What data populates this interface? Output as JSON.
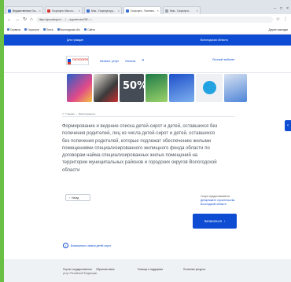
{
  "browser": {
    "tabs": [
      {
        "label": "Ведомственные Гос...",
        "active": false,
        "color": "#3b6fd0"
      },
      {
        "label": "Госуслуги: Мои кл...",
        "active": false,
        "color": "#d8382f"
      },
      {
        "label": "Мои - Госуслуги.ру...",
        "active": false,
        "color": "#3b6fd0"
      },
      {
        "label": "Госуслуги - Полезно...",
        "active": true,
        "color": "#3b6fd0"
      },
      {
        "label": "Мои - Госуслуги...",
        "active": false,
        "color": "#9aa3ae"
      }
    ],
    "url": "https://gosuslugi.ru/...../...../pgu/service/35/.../...",
    "bookmarks": [
      "Сервисы",
      "Госуслуги",
      "Почта",
      "Вологодская обл.",
      "Сайты"
    ],
    "other_bookmarks": "Другие закладки"
  },
  "site": {
    "top_bar": {
      "left": "Для граждан",
      "right": "Вологодская область"
    },
    "logo": {
      "text": "ГОСУСЛУГИ"
    },
    "nav": {
      "items": [
        "Каталог услуг",
        "Оплата"
      ],
      "search_icon": "search-icon"
    },
    "cabinet": "Личный кабинет",
    "banner_3_text": "50%",
    "breadcrumb": [
      "Главная",
      "Минсоцзащиты"
    ],
    "description": "Формирование и ведение списка детей-сирот и детей, оставшихся без попечения родителей, лиц из числа детей-сирот и детей, оставшихся без попечения родителей, которые подлежат обеспечению жилыми помещениями специализированного жилищного фонда области по договорам найма специализированных жилых помещений на территории муниципальных районов и городских округов Вологодской области",
    "back_button": "Назад",
    "side_box": {
      "line1": "Услуга предоставляется",
      "link": "Департамент строительства Вологодской области"
    },
    "primary_button": "Записаться",
    "info_link": "Возможность записи детей-сирот",
    "footer": {
      "col1": [
        "Портал государственных",
        "услуг Российской Федерации"
      ],
      "col2": "Обратная связь",
      "col3": "Помощь и поддержка",
      "col4": "Полезные ресурсы"
    }
  },
  "colors": {
    "accent": "#0d4cd3",
    "left_strip": "#6abf45"
  }
}
